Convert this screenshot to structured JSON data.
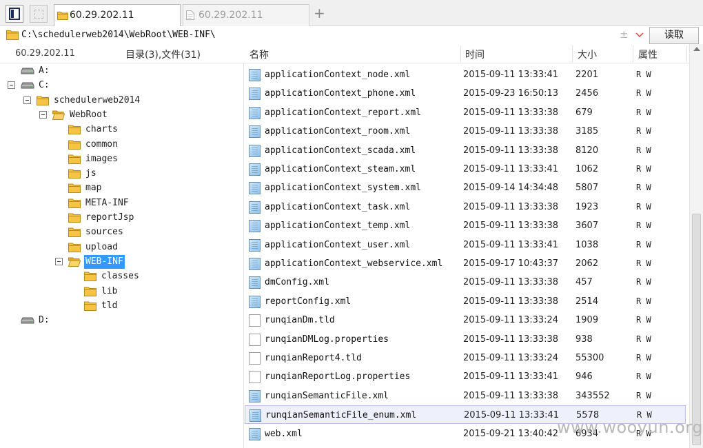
{
  "tabs": [
    {
      "label": "60.29.202.11",
      "active": true
    },
    {
      "label": "60.29.202.11",
      "active": false
    }
  ],
  "tab_add": "+",
  "address": {
    "path": "C:\\schedulerweb2014\\WebRoot\\WEB-INF\\",
    "pm": "±",
    "read_label": "读取"
  },
  "header": {
    "ip": "60.29.202.11",
    "count": "目录(3),文件(31)",
    "col_name": "名称",
    "col_time": "时间",
    "col_size": "大小",
    "col_attr": "属性"
  },
  "tree": [
    {
      "label": "A:",
      "type": "drive",
      "level": 0,
      "expander": false
    },
    {
      "label": "C:",
      "type": "drive",
      "level": 0,
      "expander": true
    },
    {
      "label": "schedulerweb2014",
      "type": "folder",
      "level": 1,
      "expander": true
    },
    {
      "label": "WebRoot",
      "type": "folder",
      "level": 2,
      "expander": true,
      "open": true
    },
    {
      "label": "charts",
      "type": "folder",
      "level": 3
    },
    {
      "label": "common",
      "type": "folder",
      "level": 3
    },
    {
      "label": "images",
      "type": "folder",
      "level": 3
    },
    {
      "label": "js",
      "type": "folder",
      "level": 3
    },
    {
      "label": "map",
      "type": "folder",
      "level": 3
    },
    {
      "label": "META-INF",
      "type": "folder",
      "level": 3
    },
    {
      "label": "reportJsp",
      "type": "folder",
      "level": 3
    },
    {
      "label": "sources",
      "type": "folder",
      "level": 3
    },
    {
      "label": "upload",
      "type": "folder",
      "level": 3
    },
    {
      "label": "WEB-INF",
      "type": "folder",
      "level": 3,
      "expander": true,
      "selected": true,
      "open": true
    },
    {
      "label": "classes",
      "type": "folder",
      "level": 4
    },
    {
      "label": "lib",
      "type": "folder",
      "level": 4
    },
    {
      "label": "tld",
      "type": "folder",
      "level": 4
    },
    {
      "label": "D:",
      "type": "drive",
      "level": 0,
      "expander": false
    }
  ],
  "files": [
    {
      "name": "applicationContext_node.xml",
      "time": "2015-09-11 13:33:41",
      "size": "2201",
      "attr": "R W",
      "icon": "xml"
    },
    {
      "name": "applicationContext_phone.xml",
      "time": "2015-09-23 16:50:13",
      "size": "2456",
      "attr": "R W",
      "icon": "xml"
    },
    {
      "name": "applicationContext_report.xml",
      "time": "2015-09-11 13:33:38",
      "size": "679",
      "attr": "R W",
      "icon": "xml"
    },
    {
      "name": "applicationContext_room.xml",
      "time": "2015-09-11 13:33:38",
      "size": "3185",
      "attr": "R W",
      "icon": "xml"
    },
    {
      "name": "applicationContext_scada.xml",
      "time": "2015-09-11 13:33:38",
      "size": "8120",
      "attr": "R W",
      "icon": "xml"
    },
    {
      "name": "applicationContext_steam.xml",
      "time": "2015-09-11 13:33:41",
      "size": "1062",
      "attr": "R W",
      "icon": "xml"
    },
    {
      "name": "applicationContext_system.xml",
      "time": "2015-09-14 14:34:48",
      "size": "5807",
      "attr": "R W",
      "icon": "xml"
    },
    {
      "name": "applicationContext_task.xml",
      "time": "2015-09-11 13:33:38",
      "size": "1923",
      "attr": "R W",
      "icon": "xml"
    },
    {
      "name": "applicationContext_temp.xml",
      "time": "2015-09-11 13:33:38",
      "size": "3607",
      "attr": "R W",
      "icon": "xml"
    },
    {
      "name": "applicationContext_user.xml",
      "time": "2015-09-11 13:33:41",
      "size": "1038",
      "attr": "R W",
      "icon": "xml"
    },
    {
      "name": "applicationContext_webservice.xml",
      "time": "2015-09-17 10:43:37",
      "size": "2062",
      "attr": "R W",
      "icon": "xml"
    },
    {
      "name": "dmConfig.xml",
      "time": "2015-09-11 13:33:38",
      "size": "457",
      "attr": "R W",
      "icon": "xml"
    },
    {
      "name": "reportConfig.xml",
      "time": "2015-09-11 13:33:38",
      "size": "2514",
      "attr": "R W",
      "icon": "xml"
    },
    {
      "name": "runqianDm.tld",
      "time": "2015-09-11 13:33:24",
      "size": "1909",
      "attr": "R W",
      "icon": "doc"
    },
    {
      "name": "runqianDMLog.properties",
      "time": "2015-09-11 13:33:38",
      "size": "938",
      "attr": "R W",
      "icon": "doc"
    },
    {
      "name": "runqianReport4.tld",
      "time": "2015-09-11 13:33:24",
      "size": "55300",
      "attr": "R W",
      "icon": "doc"
    },
    {
      "name": "runqianReportLog.properties",
      "time": "2015-09-11 13:33:41",
      "size": "946",
      "attr": "R W",
      "icon": "doc"
    },
    {
      "name": "runqianSemanticFile.xml",
      "time": "2015-09-11 13:33:38",
      "size": "343552",
      "attr": "R W",
      "icon": "xml"
    },
    {
      "name": "runqianSemanticFile_enum.xml",
      "time": "2015-09-11 13:33:41",
      "size": "5578",
      "attr": "R W",
      "icon": "xml",
      "selected": true
    },
    {
      "name": "web.xml",
      "time": "2015-09-21 13:40:42",
      "size": "6934",
      "attr": "R W",
      "icon": "xml"
    }
  ],
  "watermark": "www.wooyun.org",
  "colors": {
    "selection": "#3399ff",
    "row_selected": "#eef0fb",
    "folder": "#f6c343",
    "accent_dropdown": "#d9534f"
  }
}
